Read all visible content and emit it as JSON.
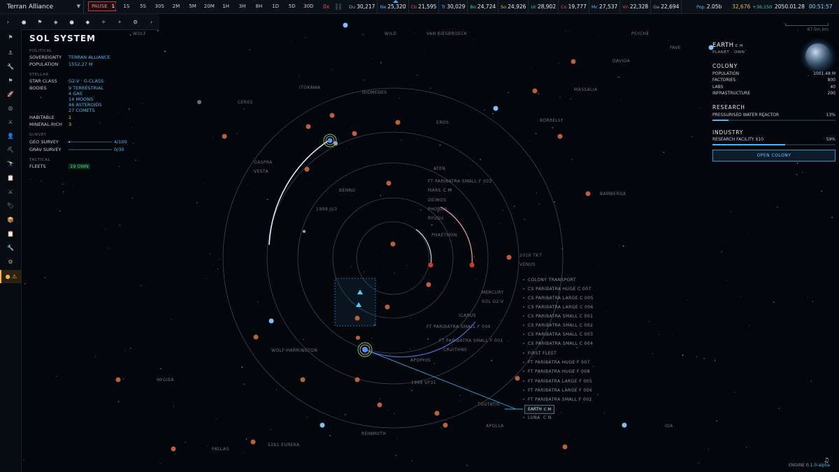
{
  "topbar": {
    "faction": "Terran Alliance",
    "pause_label": "PAUSE",
    "pause_count": "1",
    "speeds": [
      "1S",
      "5S",
      "30S",
      "2M",
      "5M",
      "20M",
      "1H",
      "3H",
      "8H",
      "1D",
      "5D",
      "30D"
    ],
    "multiplier": "0x",
    "resources": [
      {
        "sym": "Du",
        "value": "30,217",
        "color": "#9aa6b3"
      },
      {
        "sym": "Ne",
        "value": "25,320",
        "color": "#4db3ff"
      },
      {
        "sym": "Cb",
        "value": "21,595",
        "color": "#e05050"
      },
      {
        "sym": "Tr",
        "value": "30,029",
        "color": "#4db3ff"
      },
      {
        "sym": "Bo",
        "value": "24,724",
        "color": "#46d08c"
      },
      {
        "sym": "So",
        "value": "24,926",
        "color": "#f0b24a"
      },
      {
        "sym": "Ur",
        "value": "28,902",
        "color": "#46d08c"
      },
      {
        "sym": "Co",
        "value": "19,777",
        "color": "#e05050"
      },
      {
        "sym": "Mc",
        "value": "27,537",
        "color": "#4db3ff"
      },
      {
        "sym": "Vn",
        "value": "22,328",
        "color": "#e05050"
      },
      {
        "sym": "Ga",
        "value": "22,694",
        "color": "#9aa6b3"
      }
    ],
    "pop_sym": "Pop",
    "pop_value": "2.05b",
    "wealth": "32,676",
    "wealth_delta": "+36,150",
    "date": "2050.01.28",
    "time": "00:51:57"
  },
  "filterbar": {
    "items": [
      "›",
      "●",
      "⚑",
      "◈",
      "●",
      "◆",
      "✧",
      "⚬",
      "⚙",
      "›"
    ]
  },
  "sidebar": {
    "icons": [
      {
        "name": "flag-icon",
        "glyph": "⚑"
      },
      {
        "name": "anchor-icon",
        "glyph": "⚓"
      },
      {
        "name": "wrench-icon",
        "glyph": "🔧"
      },
      {
        "name": "flag-alt-icon",
        "glyph": "⚑"
      },
      {
        "name": "rocket-icon",
        "glyph": "🚀"
      },
      {
        "name": "target-icon",
        "glyph": "◎"
      },
      {
        "name": "swords-icon",
        "glyph": "⚔"
      },
      {
        "name": "person-icon",
        "glyph": "👤"
      },
      {
        "name": "pickaxe-icon",
        "glyph": "⛏"
      },
      {
        "name": "telescope-icon",
        "glyph": "🔭"
      },
      {
        "name": "clipboard-icon",
        "glyph": "📋"
      },
      {
        "name": "crossed-swords-icon",
        "glyph": "⚔"
      },
      {
        "name": "tag-icon",
        "glyph": "🏷"
      },
      {
        "name": "package-icon",
        "glyph": "📦"
      },
      {
        "name": "document-icon",
        "glyph": "📋"
      },
      {
        "name": "tools-icon",
        "glyph": "🔧"
      },
      {
        "name": "settings-icon",
        "glyph": "⚙"
      },
      {
        "name": "alert-icon",
        "glyph": "● ⚠"
      }
    ]
  },
  "system": {
    "title": "SOL SYSTEM",
    "political_header": "POLITICAL",
    "sovereignty_label": "SOVEREIGNTY",
    "sovereignty": "TERRAN ALLIANCE",
    "population_label": "POPULATION",
    "population": "1552.27 M",
    "stellar_header": "STELLAR",
    "star_class_label": "STAR CLASS",
    "star_class": "G2-V · G-CLASS",
    "bodies_label": "BODIES",
    "bodies": [
      "9 TERRESTRIAL",
      "4 GAS",
      "14 MOONS",
      "46 ASTEROIDS",
      "27 COMETS"
    ],
    "habitable_label": "HABITABLE",
    "habitable": "1",
    "mineral_label": "MINERAL-RICH",
    "mineral": "3",
    "survey_header": "SURVEY",
    "geo_label": "GEO SURVEY",
    "geo_value": "4/100",
    "geo_fraction": 0.04,
    "grav_label": "GRAV SURVEY",
    "grav_value": "0/30",
    "grav_fraction": 0.0,
    "tactical_header": "TACTICAL",
    "fleets_label": "FLEETS",
    "fleets": "19 OWN"
  },
  "map_labels": {
    "bodies": [
      "WOLF",
      "WILD",
      "VAN BIESBROECK",
      "PSYCHE",
      "FAVE",
      "DAVIDA",
      "ITOKAWA",
      "DIOMEDES",
      "MASSALIA",
      "CERES",
      "BORRELLY",
      "EROS",
      "GASPRA",
      "VESTA",
      "ATEN",
      "FT PARIBATRA SMALL F 003",
      "MARS",
      "BAMBERGA",
      "BENNU",
      "DEIMOS",
      "1999 JU3",
      "PHOBOS",
      "RYUGU",
      "PHAETHON",
      "2010 TK7",
      "VENUS",
      "COLONY TRANSPORT",
      "CS PARIBATRA HUGE C 007",
      "MERCURY",
      "CS PARIBATRA LARGE C 005",
      "SOL G2-V",
      "CS PARIBATRA LARGE C 006",
      "ICARUS",
      "CS PARIBATRA SMALL C 001",
      "FT PARIBATRA SMALL F 004",
      "CS PARIBATRA SMALL C 002",
      "FT PARIBATRA SMALL F 001",
      "CS PARIBATRA SMALL C 003",
      "CRUITHNE",
      "CS PARIBATRA SMALL C 004",
      "WOLF-HARRINGTON",
      "FIRST FLEET",
      "APOPHIS",
      "FT PARIBATRA HUGE F 007",
      "HYGIEA",
      "FT PARIBATRA HUGE F 008",
      "1998 VF31",
      "FT PARIBATRA LARGE F 005",
      "FT PARIBATRA LARGE F 006",
      "FT PARIBATRA SMALL F 002",
      "TOUTATIS",
      "LUNA",
      "APOLLA",
      "IDA",
      "REINMUTH",
      "5261 EUREKA",
      "PALLAS"
    ],
    "earth_tag": "EARTH",
    "earth_tag_marks": "C M",
    "mars_marks": "C M",
    "luna_marks": "C N"
  },
  "planet": {
    "name": "EARTH",
    "marks": "C H",
    "subtitle": "PLANET · OWN",
    "colony_header": "COLONY",
    "stats": [
      {
        "label": "POPULATION",
        "value": "1001.48 M"
      },
      {
        "label": "FACTORIES",
        "value": "800"
      },
      {
        "label": "LABS",
        "value": "40"
      },
      {
        "label": "INFRASTRUCTURE",
        "value": "200"
      }
    ],
    "research_header": "RESEARCH",
    "research_item": "PRESSURISED WATER REACTOR",
    "research_pct": "13%",
    "research_fraction": 0.13,
    "industry_header": "INDUSTRY",
    "industry_item": "RESEARCH FACILITY X10",
    "industry_pct": "59%",
    "industry_fraction": 0.59,
    "open_button": "OPEN COLONY"
  },
  "scale_label": "67.5m km",
  "engine_label": "ENGINE",
  "engine_version": "0.1.0-alpha",
  "colors": {
    "accent": "#4db3ff",
    "warning": "#f0b24a",
    "danger": "#e05050",
    "ok": "#46d08c"
  }
}
